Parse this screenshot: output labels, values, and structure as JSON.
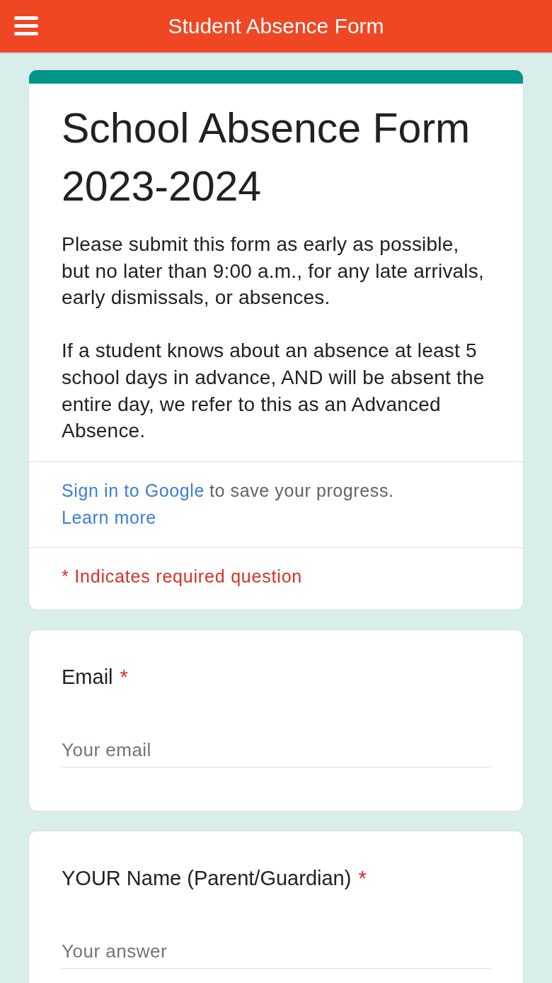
{
  "app_bar": {
    "title": "Student Absence Form"
  },
  "form_header": {
    "title": "School Absence Form 2023-2024",
    "description": [
      "Please submit this form as early as possible, but no later than 9:00 a.m., for any late arrivals, early dismissals, or absences.",
      "If a student knows about an absence at least 5 school days in advance, AND will be absent the entire day, we refer to this as an Advanced Absence."
    ],
    "sign_in": {
      "link": "Sign in to Google",
      "text": "to save your progress.",
      "learn_more": "Learn more"
    },
    "required_note": "* Indicates required question"
  },
  "questions": [
    {
      "label": "Email",
      "required": true,
      "required_mark": "*",
      "placeholder": "Your email"
    },
    {
      "label": "YOUR Name (Parent/Guardian)",
      "required": true,
      "required_mark": "*",
      "placeholder": "Your answer"
    }
  ]
}
